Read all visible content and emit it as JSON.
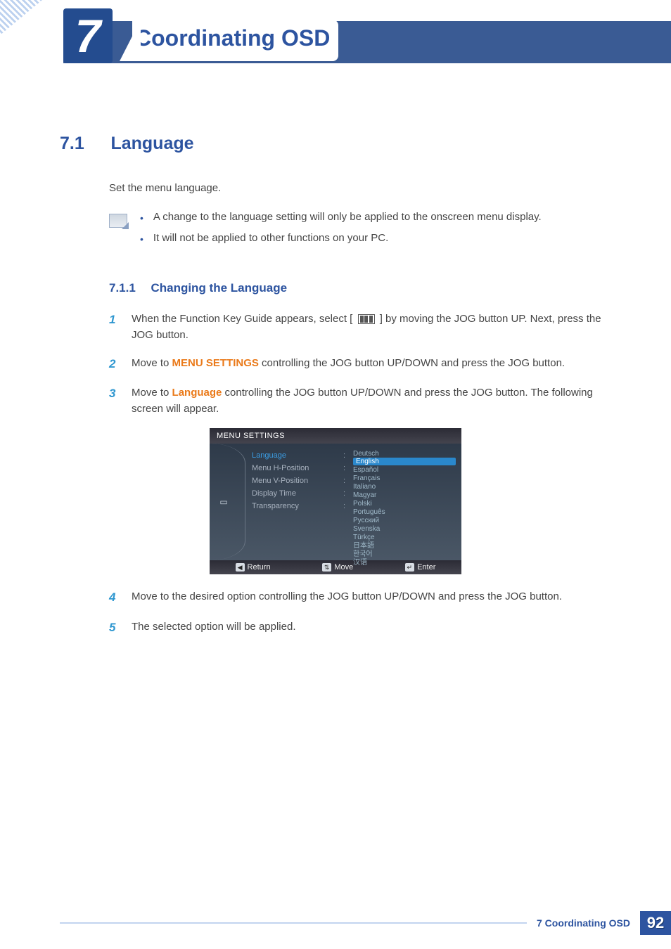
{
  "header": {
    "chapter_number": "7",
    "chapter_title": "Coordinating OSD"
  },
  "section": {
    "number": "7.1",
    "title": "Language",
    "intro": "Set the menu language.",
    "notes": [
      "A change to the language setting will only be applied to the onscreen menu display.",
      "It will not be applied to other functions on your PC."
    ]
  },
  "subsection": {
    "number": "7.1.1",
    "title": "Changing the Language"
  },
  "steps": {
    "s1a": "When the Function Key Guide appears, select [",
    "s1b": "] by moving the JOG button UP. Next, press the JOG button.",
    "s2a": "Move to ",
    "s2kw": "MENU SETTINGS",
    "s2b": " controlling the JOG button UP/DOWN and press the JOG button.",
    "s3a": "Move to ",
    "s3kw": "Language",
    "s3b": " controlling the JOG button UP/DOWN and press the JOG button. The following screen will appear.",
    "s4": "Move to the desired option controlling the JOG button UP/DOWN and press the JOG button.",
    "s5": "The selected option will be applied."
  },
  "osd": {
    "title": "MENU SETTINGS",
    "items": {
      "language": "Language",
      "hpos": "Menu H-Position",
      "vpos": "Menu V-Position",
      "dtime": "Display Time",
      "transp": "Transparency"
    },
    "languages": [
      "Deutsch",
      "English",
      "Español",
      "Français",
      "Italiano",
      "Magyar",
      "Polski",
      "Português",
      "Русский",
      "Svenska",
      "Türkçe",
      "日本語",
      "한국어",
      "汉语"
    ],
    "selected_language_index": 1,
    "footer": {
      "return": "Return",
      "move": "Move",
      "enter": "Enter"
    }
  },
  "page_footer": {
    "label": "7 Coordinating OSD",
    "page": "92"
  }
}
